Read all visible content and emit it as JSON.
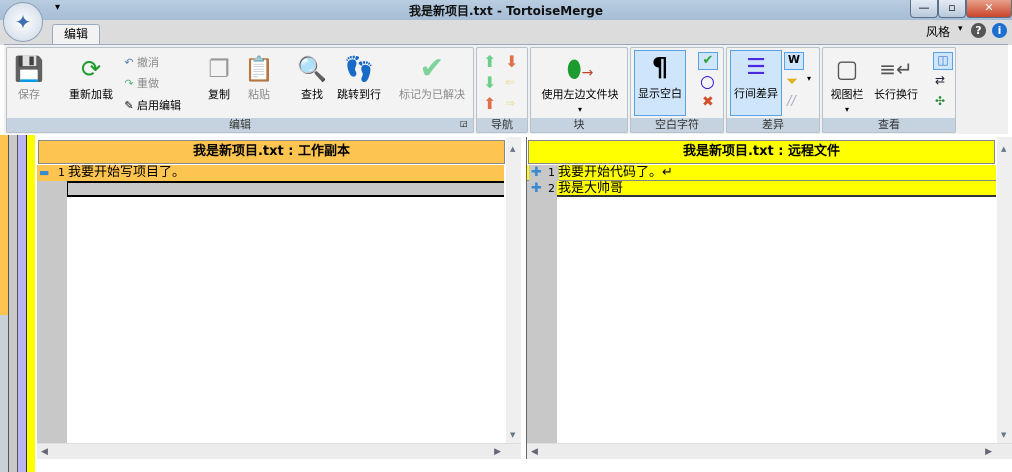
{
  "window": {
    "title": "我是新项目.txt - TortoiseMerge",
    "qat": "▾",
    "minimize": "—",
    "maximize": "▫",
    "close": "✕"
  },
  "tabs": [
    {
      "label": "编辑"
    }
  ],
  "style_menu": {
    "label": "风格",
    "arrow": "▾",
    "help": "?",
    "about": "i"
  },
  "groups": {
    "edit": {
      "label": "编辑",
      "save": "保存",
      "reload": "重新加载",
      "undo": "撤消",
      "redo": "重做",
      "enable_edit": "启用编辑",
      "copy": "复制",
      "paste": "粘贴",
      "find": "查找",
      "goto": "跳转到行",
      "mark_resolved": "标记为已解决"
    },
    "nav": {
      "label": "导航"
    },
    "block": {
      "label": "块",
      "use_left": "使用左边文件块",
      "arrow": "▾"
    },
    "whitespace": {
      "label": "空白字符",
      "show_ws": "显示空白"
    },
    "diff": {
      "label": "差异",
      "inline_diff": "行间差异"
    },
    "view": {
      "label": "查看",
      "view_bar": "视图栏",
      "wrap": "长行换行",
      "arrow": "▾"
    }
  },
  "left_pane": {
    "header": "我是新项目.txt : 工作副本",
    "lines": [
      {
        "num": "1",
        "text": "我要开始写项目了。",
        "bg": "#fdc44f"
      }
    ]
  },
  "right_pane": {
    "header": "我是新项目.txt : 远程文件",
    "lines": [
      {
        "num": "1",
        "text": "我要开始代码了。↵",
        "bg": "#ffff00"
      },
      {
        "num": "2",
        "text": "我是大帅哥",
        "bg": "#ffff00"
      }
    ]
  },
  "colors": {
    "working": "#fdc44f",
    "remote": "#ffff00"
  }
}
